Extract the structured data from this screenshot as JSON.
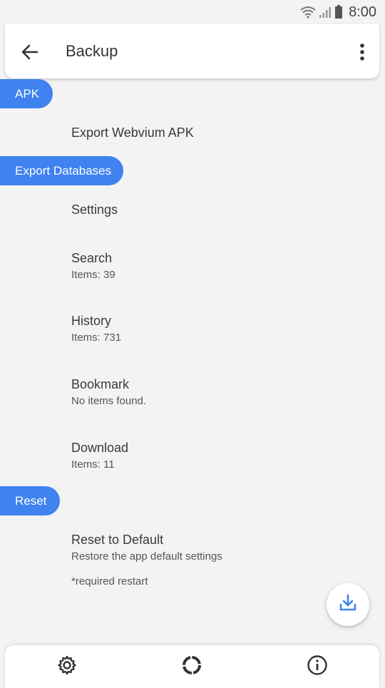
{
  "status": {
    "time": "8:00",
    "icons": [
      "wifi-icon",
      "signal-icon",
      "battery-icon"
    ]
  },
  "appbar": {
    "title": "Backup",
    "back_icon": "arrow-left-icon",
    "menu_icon": "more-vertical-icon"
  },
  "sections": {
    "apk": {
      "label": "APK",
      "items": [
        {
          "title": "Export Webvium APK"
        }
      ]
    },
    "export_databases": {
      "label": "Export Databases",
      "items": [
        {
          "title": "Settings"
        },
        {
          "title": "Search",
          "subtitle": "Items: 39"
        },
        {
          "title": "History",
          "subtitle": "Items: 731"
        },
        {
          "title": "Bookmark",
          "subtitle": "No items found."
        },
        {
          "title": "Download",
          "subtitle": "Items: 11"
        }
      ]
    },
    "reset": {
      "label": "Reset",
      "items": [
        {
          "title": "Reset to Default",
          "subtitle": "Restore the app default settings"
        }
      ],
      "note": "*required restart"
    }
  },
  "fab": {
    "icon": "download-icon"
  },
  "bottom_nav": {
    "icons": [
      "gear-icon",
      "loading-ring-icon",
      "info-icon"
    ]
  },
  "colors": {
    "accent": "#3f82f0",
    "background": "#f3f3f3",
    "surface": "#ffffff"
  }
}
